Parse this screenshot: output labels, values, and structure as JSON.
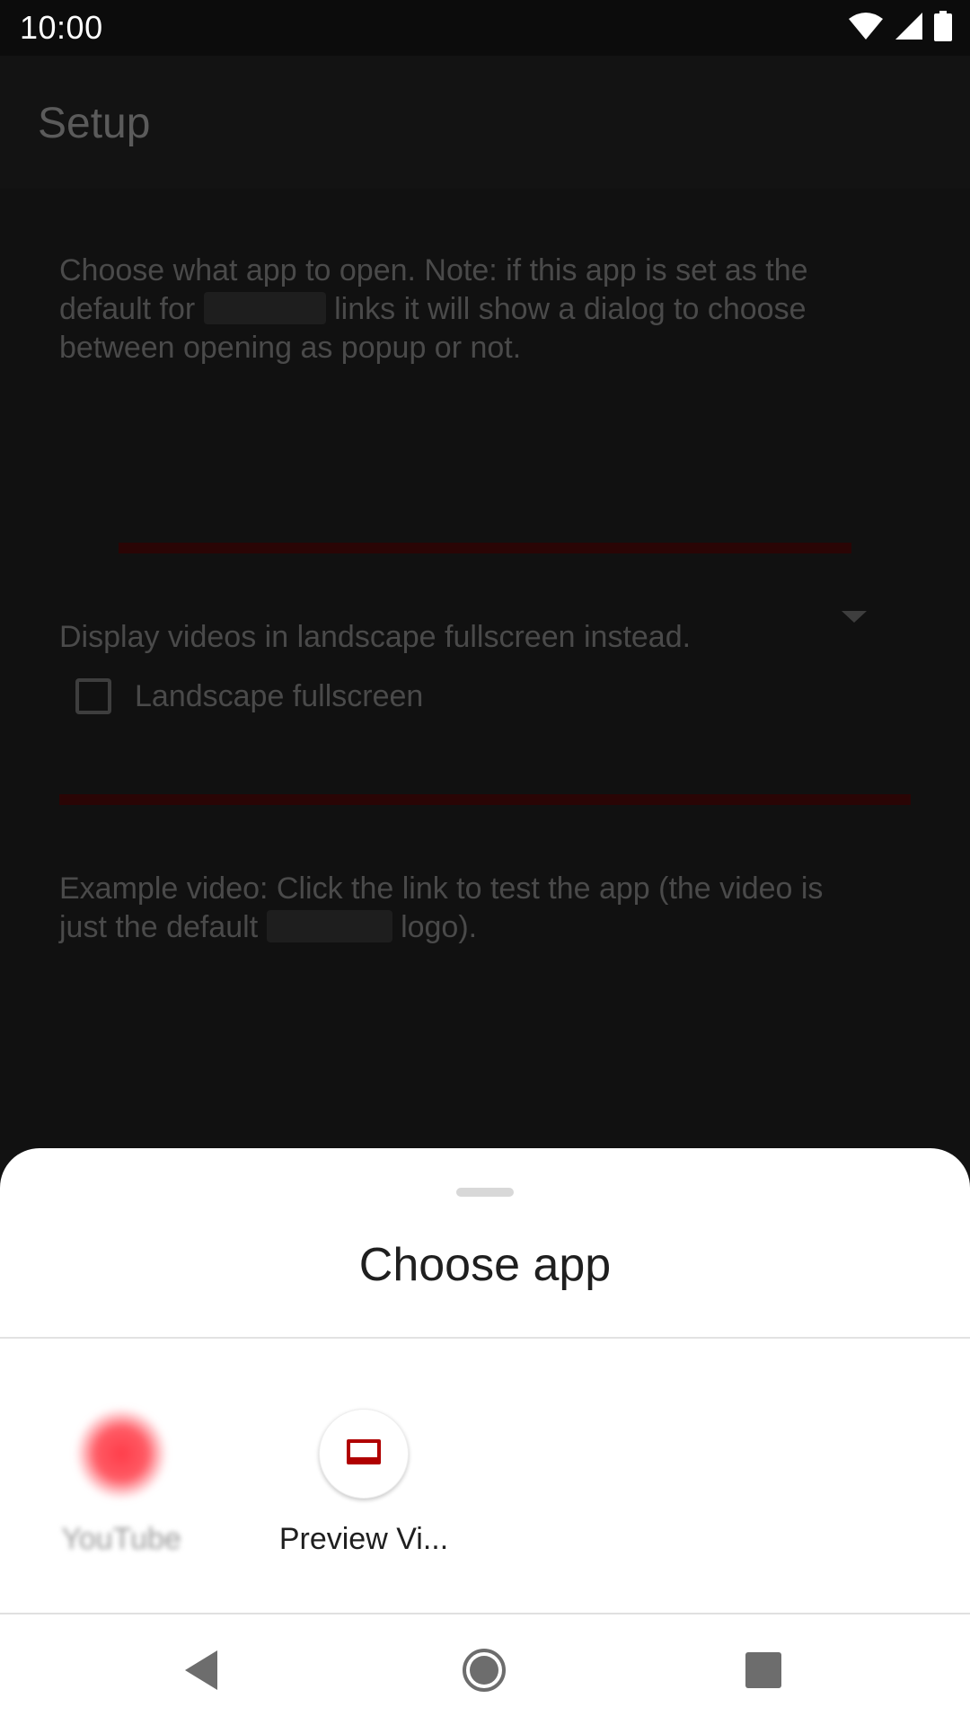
{
  "status_bar": {
    "time": "10:00",
    "icons": [
      "wifi-icon",
      "cellular-signal-icon",
      "battery-icon"
    ]
  },
  "app_bar": {
    "title": "Setup"
  },
  "setup": {
    "app_choice_description_line1": "Choose what app to open. Note: if this app is set as the",
    "app_choice_description_line2_before": "default for",
    "app_choice_description_line2_after": "links it will show a dialog to choose",
    "app_choice_description_line3": "between opening as popup or not.",
    "landscape_description": "Display videos in landscape fullscreen instead.",
    "landscape_checkbox_label": "Landscape fullscreen",
    "landscape_checked": false,
    "example_description_line1": "Example video: Click the link to test the app (the video is",
    "example_description_line2_before": "just the default",
    "example_description_line2_after": "logo)."
  },
  "chooser": {
    "title": "Choose app",
    "apps": [
      {
        "label": "YouTube",
        "icon": "youtube-icon"
      },
      {
        "label": "Preview Vi...",
        "icon": "preview-video-icon"
      }
    ]
  },
  "nav_bar": {
    "buttons": [
      "back-icon",
      "home-icon",
      "recents-icon"
    ]
  },
  "colors": {
    "accent_red": "#b00000",
    "sheet_background": "#ffffff",
    "scrim": "#121212"
  }
}
